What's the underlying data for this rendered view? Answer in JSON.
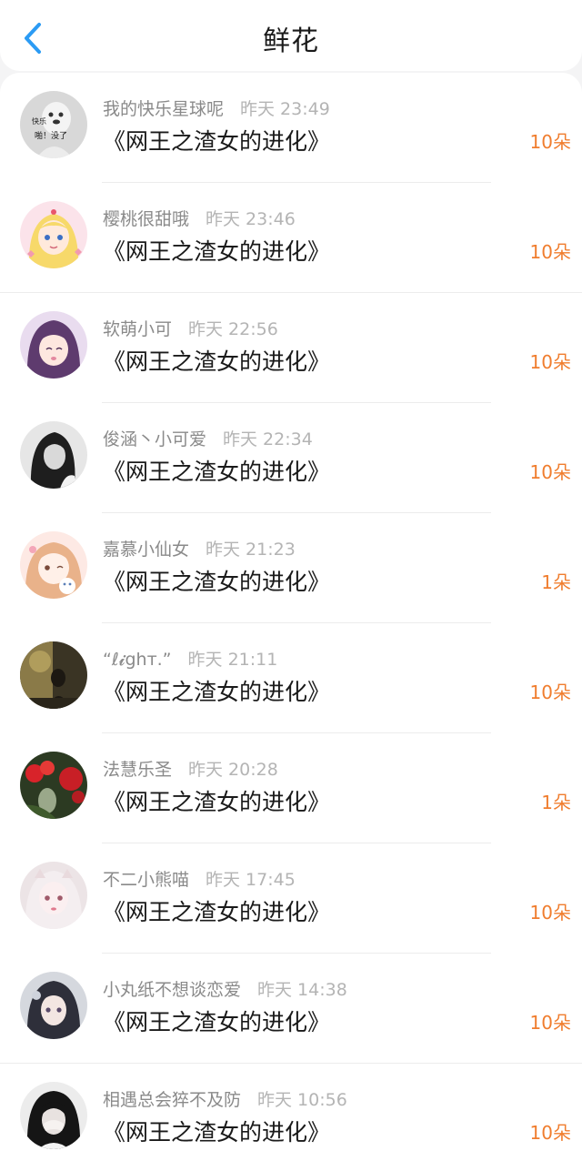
{
  "header": {
    "title": "鲜花",
    "back_icon": "chevron-left-icon",
    "accent": "#2b9bf4"
  },
  "colors": {
    "count": "#f07d2e",
    "nickname": "#8a8a8a",
    "time": "#b4b4b4"
  },
  "rows": [
    {
      "nickname": "我的快乐星球呢",
      "time": "昨天 23:49",
      "book": "《网王之渣女的进化》",
      "count": "10朵",
      "avatar_text_1": "快乐",
      "avatar_text_2": "啪！没了"
    },
    {
      "nickname": "樱桃很甜哦",
      "time": "昨天 23:46",
      "book": "《网王之渣女的进化》",
      "count": "10朵"
    },
    {
      "nickname": "软萌小可",
      "time": "昨天 22:56",
      "book": "《网王之渣女的进化》",
      "count": "10朵"
    },
    {
      "nickname": "俊涵丶小可爱",
      "time": "昨天 22:34",
      "book": "《网王之渣女的进化》",
      "count": "10朵"
    },
    {
      "nickname": "嘉慕小仙女",
      "time": "昨天 21:23",
      "book": "《网王之渣女的进化》",
      "count": "1朵"
    },
    {
      "nickname": "“ℓ𝓲ghт.”",
      "time": "昨天 21:11",
      "book": "《网王之渣女的进化》",
      "count": "10朵"
    },
    {
      "nickname": "法慧乐圣",
      "time": "昨天 20:28",
      "book": "《网王之渣女的进化》",
      "count": "1朵"
    },
    {
      "nickname": "不二小熊喵",
      "time": "昨天 17:45",
      "book": "《网王之渣女的进化》",
      "count": "10朵"
    },
    {
      "nickname": "小丸纸不想谈恋爱",
      "time": "昨天 14:38",
      "book": "《网王之渣女的进化》",
      "count": "10朵"
    },
    {
      "nickname": "相遇总会猝不及防",
      "time": "昨天 10:56",
      "book": "《网王之渣女的进化》",
      "count": "10朵"
    }
  ]
}
